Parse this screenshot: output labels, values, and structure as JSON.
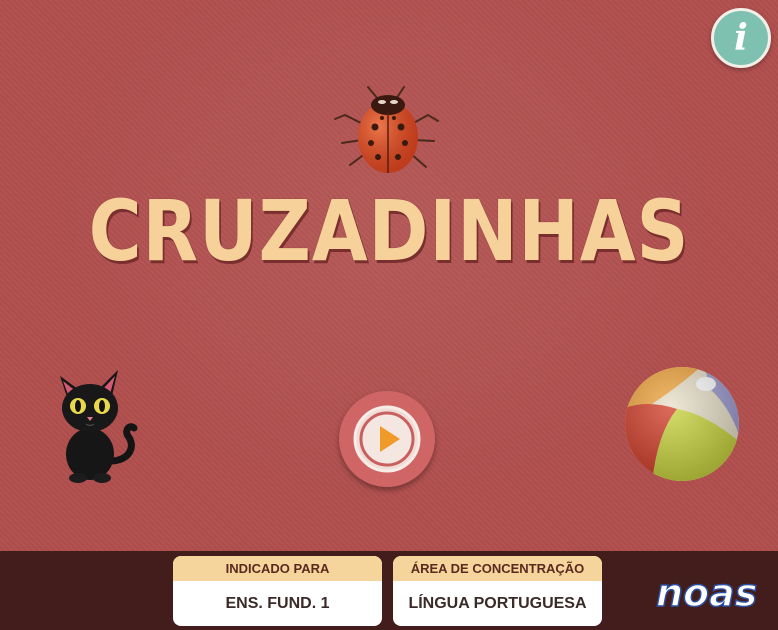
{
  "title": "CRUZADINHAS",
  "info_button": {
    "icon": "info-icon",
    "label": "i"
  },
  "play_button": {
    "icon": "play-icon"
  },
  "decorations": [
    "ladybug-icon",
    "black-cat-icon",
    "beach-ball-icon"
  ],
  "footer": {
    "cards": [
      {
        "header": "INDICADO PARA",
        "value": "ENS. FUND. 1"
      },
      {
        "header": "ÁREA DE CONCENTRAÇÃO",
        "value": "LÍNGUA PORTUGUESA"
      }
    ],
    "logo_text": "noas"
  },
  "colors": {
    "background": "#b04f4e",
    "title": "#f6d199",
    "footer": "#431d1c",
    "card_header": "#f6d59c",
    "info_button": "#7fc1b1",
    "play_button": "#cf6565"
  }
}
